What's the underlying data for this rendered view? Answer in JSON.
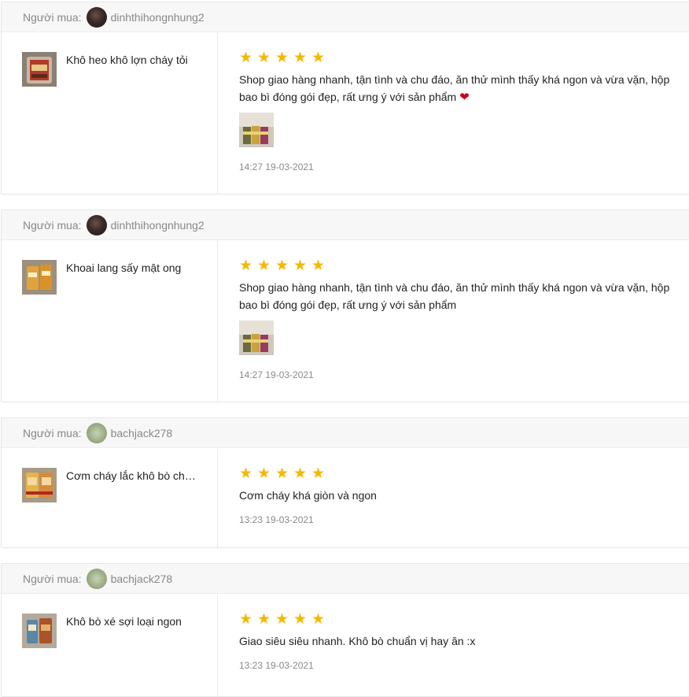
{
  "reviews": [
    {
      "buyer_label": "Người mua:",
      "avatar": "avatar-photo-dark",
      "username": "dinhthihongnhung2",
      "product_name": "Khô heo khô lợn cháy tỏi",
      "product_thumb": "product-thumb-dried-pork",
      "rating": 5,
      "stars": [
        "★",
        "★",
        "★",
        "★",
        "★"
      ],
      "comment": "Shop giao hàng nhanh, tận tình và chu đáo, ăn thử mình thấy khá ngon và vừa vặn, hộp bao bì đóng gói đẹp, rất ưng ý với sản phẩm",
      "emoji": "❤",
      "photo": "review-photo-snack-jars",
      "timestamp": "14:27 19-03-2021"
    },
    {
      "buyer_label": "Người mua:",
      "avatar": "avatar-photo-dark",
      "username": "dinhthihongnhung2",
      "product_name": "Khoai lang sấy mật ong",
      "product_thumb": "product-thumb-sweet-potato",
      "rating": 5,
      "stars": [
        "★",
        "★",
        "★",
        "★",
        "★"
      ],
      "comment": "Shop giao hàng nhanh, tận tình và chu đáo, ăn thử mình thấy khá ngon và vừa vặn, hộp bao bì đóng gói đẹp, rất ưng ý với sản phẩm",
      "emoji": "",
      "photo": "review-photo-snack-jars",
      "timestamp": "14:27 19-03-2021"
    },
    {
      "buyer_label": "Người mua:",
      "avatar": "avatar-photo-green",
      "username": "bachjack278",
      "product_name": "Cơm cháy lắc khô bò chà bông",
      "product_thumb": "product-thumb-rice-crisp",
      "rating": 5,
      "stars": [
        "★",
        "★",
        "★",
        "★",
        "★"
      ],
      "comment": "Cơm cháy khá giòn và ngon",
      "emoji": "",
      "photo": "",
      "timestamp": "13:23 19-03-2021"
    },
    {
      "buyer_label": "Người mua:",
      "avatar": "avatar-photo-green",
      "username": "bachjack278",
      "product_name": "Khô bò xé sợi loại ngon",
      "product_thumb": "product-thumb-shredded-beef",
      "rating": 5,
      "stars": [
        "★",
        "★",
        "★",
        "★",
        "★"
      ],
      "comment": "Giao siêu siêu nhanh. Khô bò chuẩn vị hay ăn :x",
      "emoji": "",
      "photo": "",
      "timestamp": "13:23 19-03-2021"
    }
  ],
  "colors": {
    "star": "#f5b800",
    "heart": "#d0011b",
    "header_bg": "#f7f7f7",
    "muted_text": "#888888"
  }
}
